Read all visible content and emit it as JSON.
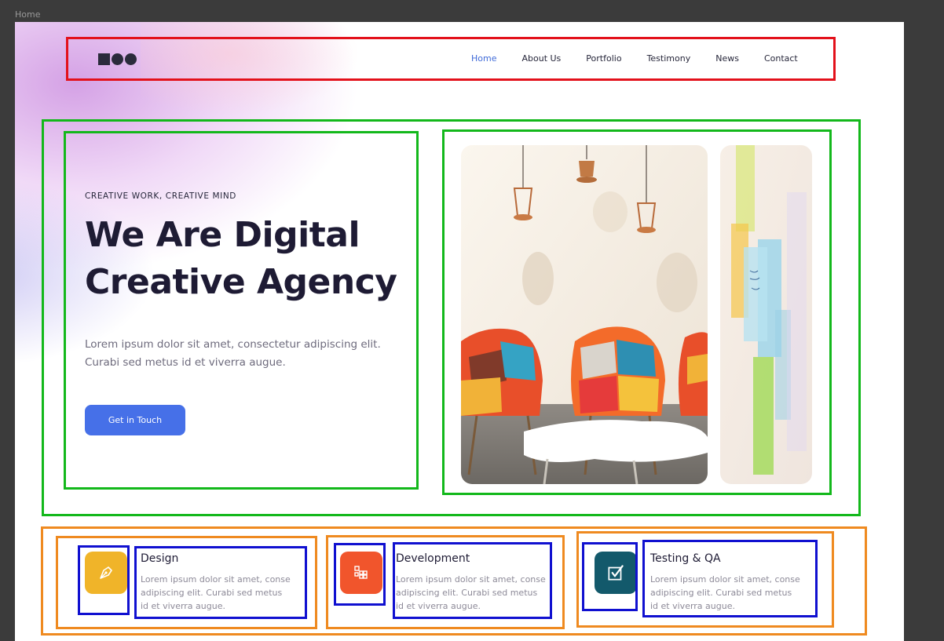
{
  "frame": {
    "label": "Home"
  },
  "nav": {
    "logo_name": "squares-circles-logo",
    "items": [
      {
        "label": "Home",
        "active": true
      },
      {
        "label": "About Us",
        "active": false
      },
      {
        "label": "Portfolio",
        "active": false
      },
      {
        "label": "Testimony",
        "active": false
      },
      {
        "label": "News",
        "active": false
      },
      {
        "label": "Contact",
        "active": false
      }
    ]
  },
  "hero": {
    "eyebrow": "CREATIVE WORK, CREATIVE MIND",
    "headline_line1": "We Are Digital",
    "headline_line2": "Creative Agency",
    "intro_line1": "Lorem ipsum dolor sit amet, consectetur adipiscing elit.",
    "intro_line2": "Curabi sed metus id et viverra augue.",
    "cta_label": "Get in Touch",
    "images": [
      "office-chairs-photo",
      "sticky-notes-photo"
    ]
  },
  "features": [
    {
      "title": "Design",
      "line1": "Lorem ipsum dolor sit amet, conse",
      "line2": "adipiscing elit. Curabi sed metus",
      "line3": "id et viverra augue.",
      "icon": "pen-nib-icon",
      "color": "#f0b429"
    },
    {
      "title": "Development",
      "line1": "Lorem ipsum dolor sit amet, conse",
      "line2": "adipiscing elit. Curabi sed metus",
      "line3": "id et viverra augue.",
      "icon": "grid-blocks-icon",
      "color": "#f1552c"
    },
    {
      "title": "Testing & QA",
      "line1": "Lorem ipsum dolor sit amet, conse",
      "line2": "adipiscing elit. Curabi sed metus",
      "line3": "id et viverra augue.",
      "icon": "checkbox-icon",
      "color": "#13596b"
    }
  ],
  "colors": {
    "accent": "#4670e8",
    "heading": "#1e1b34",
    "annotation_red": "#e3111b",
    "annotation_green": "#13b81b",
    "annotation_orange": "#ef8a20",
    "annotation_blue": "#1010d0"
  }
}
